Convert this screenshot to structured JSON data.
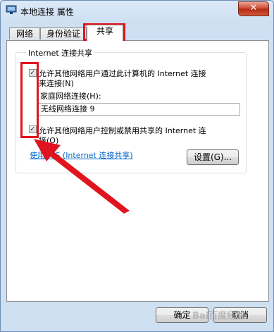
{
  "window": {
    "title": "本地连接 属性",
    "close_glyph": "✕"
  },
  "tabs": [
    {
      "label": "网络"
    },
    {
      "label": "身份验证"
    },
    {
      "label": "共享"
    }
  ],
  "group": {
    "title": "Internet 连接共享",
    "allow_share": {
      "checked": true,
      "check_glyph": "✓",
      "line1": "允许其他网络用户通过此计算机的 Internet 连接",
      "line2": "来连接(N)"
    },
    "home_network_label": "家庭网络连接(H):",
    "home_network_value": "无线网络连接 9",
    "allow_control": {
      "checked": true,
      "check_glyph": "✓",
      "line1": "允许其他网络用户控制或禁用共享的 Internet 连",
      "line2": "接(O)"
    },
    "ics_link": "使用 ICS (Internet 连接共享)",
    "settings_button": "设置(G)..."
  },
  "footer": {
    "ok_button": "确定",
    "cancel_button": "取消"
  },
  "annotation": {
    "color": "#e0141e"
  },
  "watermark": "Bai百度经验"
}
